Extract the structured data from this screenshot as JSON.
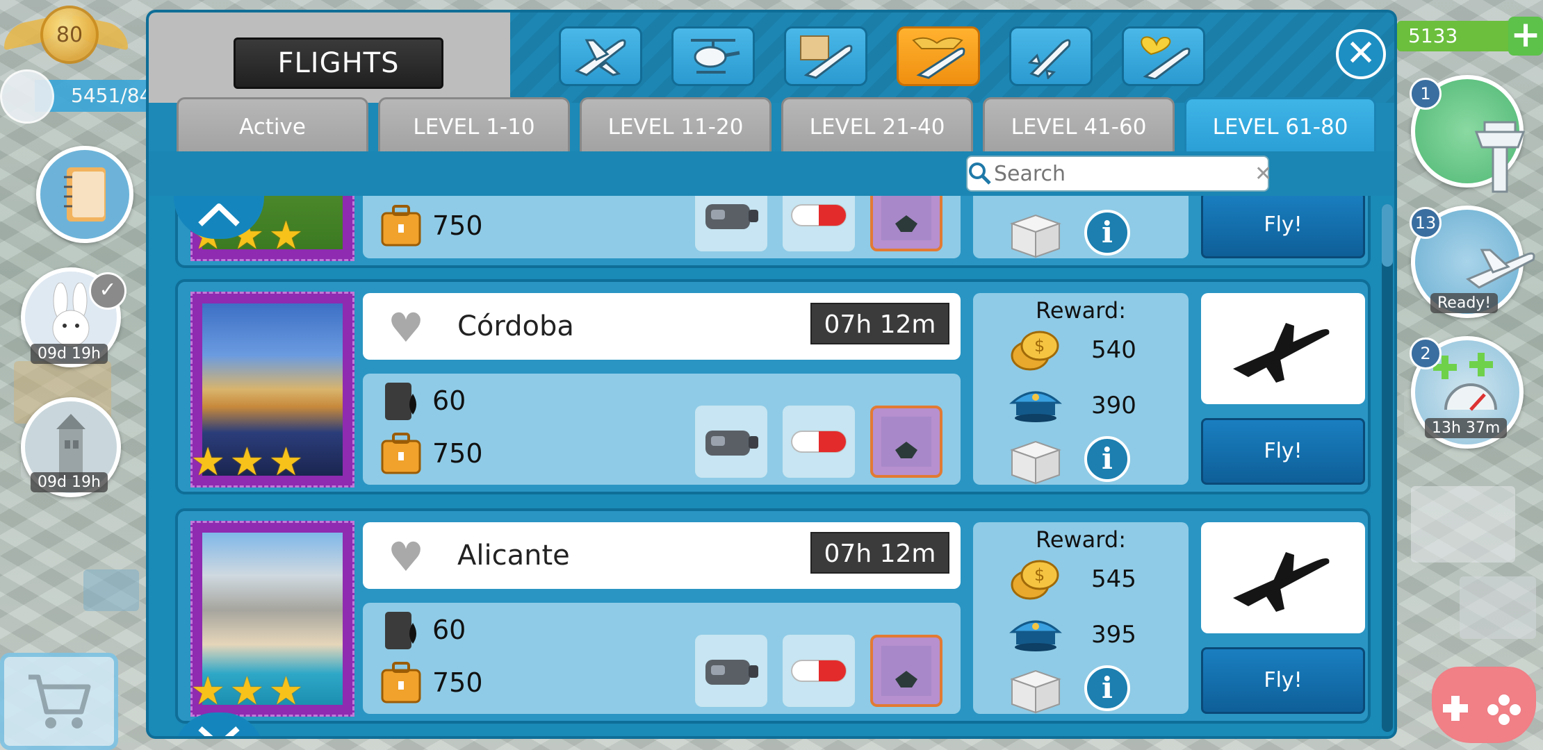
{
  "hud": {
    "level": "80",
    "population": "5451/84",
    "timer1": "09d 19h",
    "timer2": "09d 19h",
    "coins": "5133",
    "plus": "+",
    "tower_count": "1",
    "flights_count": "13",
    "ready_label": "Ready!",
    "boost_count": "2",
    "boost_timer": "13h 37m"
  },
  "modal": {
    "title": "FLIGHTS",
    "close": "✕",
    "categories": [
      "plane-icon",
      "helicopter-icon",
      "map-plane-icon",
      "wing-plane-icon",
      "rocket-icon",
      "heart-plane-icon"
    ],
    "active_category": "wing-plane-icon",
    "tabs": [
      "Active",
      "LEVEL 1-10",
      "LEVEL 11-20",
      "LEVEL 21-40",
      "LEVEL 41-60",
      "LEVEL 61-80"
    ],
    "active_tab": "LEVEL 61-80",
    "search_placeholder": "Search"
  },
  "flights": [
    {
      "city": "",
      "fuel": "",
      "passengers": "750",
      "reward_coins": "",
      "reward_xp": "",
      "fly": "Fly!"
    },
    {
      "city": "Córdoba",
      "duration": "07h 12m",
      "fuel": "60",
      "passengers": "750",
      "reward_label": "Reward:",
      "reward_coins": "540",
      "reward_xp": "390",
      "fly": "Fly!",
      "info": "i"
    },
    {
      "city": "Alicante",
      "duration": "07h 12m",
      "fuel": "60",
      "passengers": "750",
      "reward_label": "Reward:",
      "reward_coins": "545",
      "reward_xp": "395",
      "fly": "Fly!",
      "info": "i"
    }
  ],
  "colors": {
    "accent_blue": "#1c89b6",
    "active_orange": "#f08f10",
    "fly_blue": "#0e5f98",
    "star_gold": "#f7c21a"
  }
}
